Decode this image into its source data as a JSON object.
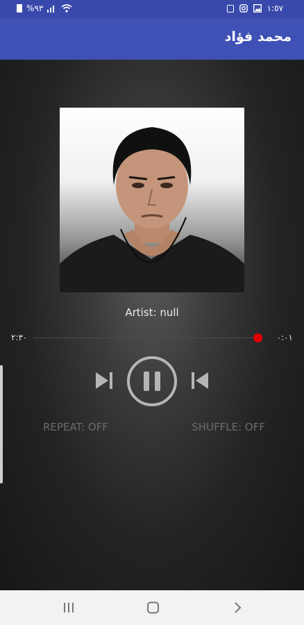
{
  "status_bar": {
    "battery_text": "%٩٣",
    "time": "١:٥٧",
    "icons": [
      "battery-icon",
      "signal-icon",
      "wifi-icon",
      "image-icon",
      "instagram-icon",
      "notification-icon"
    ]
  },
  "app_bar": {
    "title": "محمد فؤاد"
  },
  "player": {
    "artist_label": "Artist: null",
    "total_time": "٢:٣٠",
    "current_time": "٠:٠١",
    "progress": 0.0,
    "repeat_label": "REPEAT: OFF",
    "shuffle_label": "SHUFFLE: OFF",
    "state": "playing"
  },
  "colors": {
    "app_bar": "#3f51b5",
    "status_bar": "#3949ab",
    "seek_thumb": "#e00000",
    "controls": "#b5b5b5",
    "mode_text": "#6c6c6c"
  },
  "nav_bar": {
    "buttons": [
      "recents-icon",
      "home-icon",
      "back-icon"
    ]
  }
}
